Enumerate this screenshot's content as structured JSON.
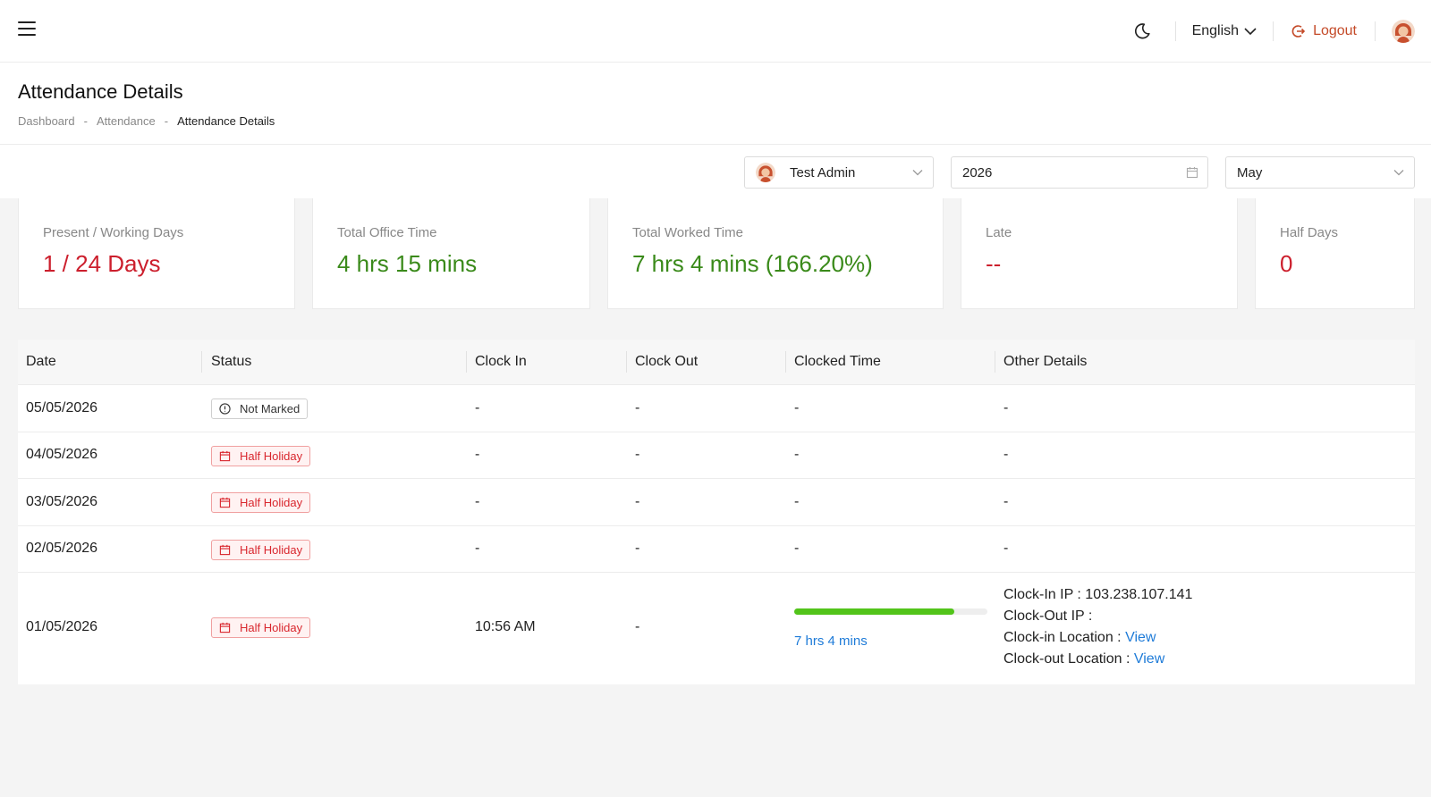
{
  "header": {
    "language": "English",
    "logout_label": "Logout"
  },
  "page": {
    "title": "Attendance Details",
    "breadcrumb": [
      "Dashboard",
      "Attendance",
      "Attendance Details"
    ]
  },
  "filters": {
    "user": "Test Admin",
    "year": "2026",
    "month": "May"
  },
  "stats": [
    {
      "label": "Present / Working Days",
      "value": "1 / 24 Days",
      "color": "#cc1f2d"
    },
    {
      "label": "Total Office Time",
      "value": "4 hrs 15 mins",
      "color": "#3a8a1a"
    },
    {
      "label": "Total Worked Time",
      "value": "7 hrs 4 mins (166.20%)",
      "color": "#3a8a1a"
    },
    {
      "label": "Late",
      "value": "--",
      "color": "#cc1f2d"
    },
    {
      "label": "Half Days",
      "value": "0",
      "color": "#cc1f2d"
    }
  ],
  "table": {
    "columns": [
      "Date",
      "Status",
      "Clock In",
      "Clock Out",
      "Clocked Time",
      "Other Details"
    ],
    "rows": [
      {
        "date": "05/05/2026",
        "status": "Not Marked",
        "clock_in": "-",
        "clock_out": "-",
        "clocked_time": "-",
        "other": "-"
      },
      {
        "date": "04/05/2026",
        "status": "Half Holiday",
        "clock_in": "-",
        "clock_out": "-",
        "clocked_time": "-",
        "other": "-"
      },
      {
        "date": "03/05/2026",
        "status": "Half Holiday",
        "clock_in": "-",
        "clock_out": "-",
        "clocked_time": "-",
        "other": "-"
      },
      {
        "date": "02/05/2026",
        "status": "Half Holiday",
        "clock_in": "-",
        "clock_out": "-",
        "clocked_time": "-",
        "other": "-"
      },
      {
        "date": "01/05/2026",
        "status": "Half Holiday",
        "clock_in": "10:56 AM",
        "clock_out": "-",
        "clocked_time": "7 hrs 4 mins",
        "clocked_progress": 0.83,
        "details": {
          "clock_in_ip_label": "Clock-In IP :",
          "clock_in_ip": "103.238.107.141",
          "clock_out_ip_label": "Clock-Out IP :",
          "clock_in_location_label": "Clock-in Location :",
          "clock_out_location_label": "Clock-out Location :",
          "view_label": "View"
        }
      }
    ]
  }
}
